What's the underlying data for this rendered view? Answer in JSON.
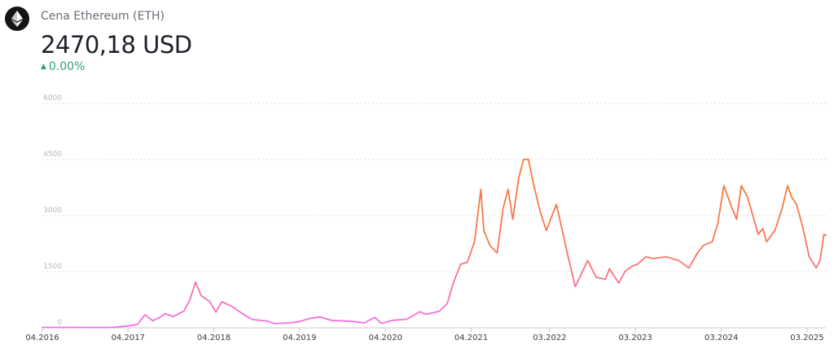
{
  "header": {
    "title": "Cena Ethereum (ETH)",
    "price": "2470,18 USD",
    "change": "0.00%",
    "change_color": "#2f9e75",
    "logo_icon": "ethereum-diamond-icon"
  },
  "chart_data": {
    "type": "line",
    "title": "Cena Ethereum (ETH)",
    "ylim": [
      0,
      6000
    ],
    "y_ticks": [
      "0",
      "1500",
      "3000",
      "4500",
      "6000"
    ],
    "x_ticks": [
      "04.2016",
      "04.2017",
      "04.2018",
      "04.2019",
      "04.2020",
      "04.2021",
      "03.2022",
      "03.2023",
      "03.2024",
      "03.2025"
    ],
    "x_tick_dates": [
      "2016-04-01",
      "2017-04-01",
      "2018-04-01",
      "2019-04-01",
      "2020-04-01",
      "2021-04-01",
      "2022-03-01",
      "2023-03-01",
      "2024-03-01",
      "2025-03-01"
    ],
    "x_range": [
      "2016-04-01",
      "2025-05-20"
    ],
    "line_colors": [
      "#f56ff2",
      "#f87660",
      "#fb7a30"
    ],
    "grid": true,
    "series": [
      {
        "x": [
          "2016-04-01",
          "2016-08-01",
          "2016-12-01",
          "2017-02-01",
          "2017-04-01",
          "2017-05-10",
          "2017-06-12",
          "2017-07-15",
          "2017-08-20",
          "2017-09-05",
          "2017-10-10",
          "2017-11-25",
          "2017-12-20",
          "2018-01-13",
          "2018-01-25",
          "2018-02-06",
          "2018-03-15",
          "2018-04-10",
          "2018-05-05",
          "2018-06-20",
          "2018-08-15",
          "2018-09-15",
          "2018-11-15",
          "2018-12-15",
          "2019-02-15",
          "2019-04-01",
          "2019-05-15",
          "2019-06-26",
          "2019-08-15",
          "2019-09-20",
          "2019-11-15",
          "2020-01-01",
          "2020-02-15",
          "2020-03-15",
          "2020-05-01",
          "2020-07-01",
          "2020-08-25",
          "2020-09-20",
          "2020-11-15",
          "2020-12-20",
          "2021-01-15",
          "2021-02-15",
          "2021-03-15",
          "2021-04-15",
          "2021-05-12",
          "2021-05-25",
          "2021-06-20",
          "2021-07-20",
          "2021-08-15",
          "2021-09-05",
          "2021-09-25",
          "2021-10-20",
          "2021-11-10",
          "2021-12-01",
          "2021-12-20",
          "2022-01-20",
          "2022-02-15",
          "2022-03-05",
          "2022-03-30",
          "2022-05-15",
          "2022-06-18",
          "2022-08-10",
          "2022-09-15",
          "2022-10-25",
          "2022-11-10",
          "2022-12-20",
          "2023-01-15",
          "2023-02-15",
          "2023-03-10",
          "2023-04-15",
          "2023-05-15",
          "2023-07-10",
          "2023-09-01",
          "2023-10-15",
          "2023-11-20",
          "2023-12-15",
          "2024-01-22",
          "2024-02-15",
          "2024-03-12",
          "2024-04-15",
          "2024-05-05",
          "2024-05-25",
          "2024-06-20",
          "2024-08-05",
          "2024-08-25",
          "2024-09-10",
          "2024-10-15",
          "2024-11-15",
          "2024-12-08",
          "2024-12-25",
          "2025-01-15",
          "2025-02-10",
          "2025-03-10",
          "2025-04-09",
          "2025-04-25",
          "2025-05-12",
          "2025-05-20"
        ],
        "y": [
          10,
          12,
          8,
          15,
          50,
          90,
          350,
          190,
          300,
          380,
          300,
          450,
          750,
          1220,
          1050,
          860,
          700,
          420,
          700,
          560,
          320,
          220,
          180,
          110,
          130,
          170,
          250,
          290,
          200,
          190,
          170,
          130,
          280,
          120,
          200,
          230,
          430,
          360,
          440,
          650,
          1200,
          1700,
          1750,
          2300,
          3700,
          2600,
          2200,
          2000,
          3200,
          3700,
          2900,
          4000,
          4500,
          4500,
          3900,
          3100,
          2600,
          2900,
          3300,
          2000,
          1100,
          1800,
          1350,
          1300,
          1580,
          1200,
          1500,
          1650,
          1700,
          1900,
          1850,
          1900,
          1800,
          1600,
          2000,
          2200,
          2300,
          2800,
          3800,
          3200,
          2900,
          3800,
          3500,
          2500,
          2650,
          2300,
          2600,
          3200,
          3800,
          3500,
          3300,
          2700,
          1900,
          1600,
          1800,
          2500,
          2470
        ]
      }
    ]
  }
}
